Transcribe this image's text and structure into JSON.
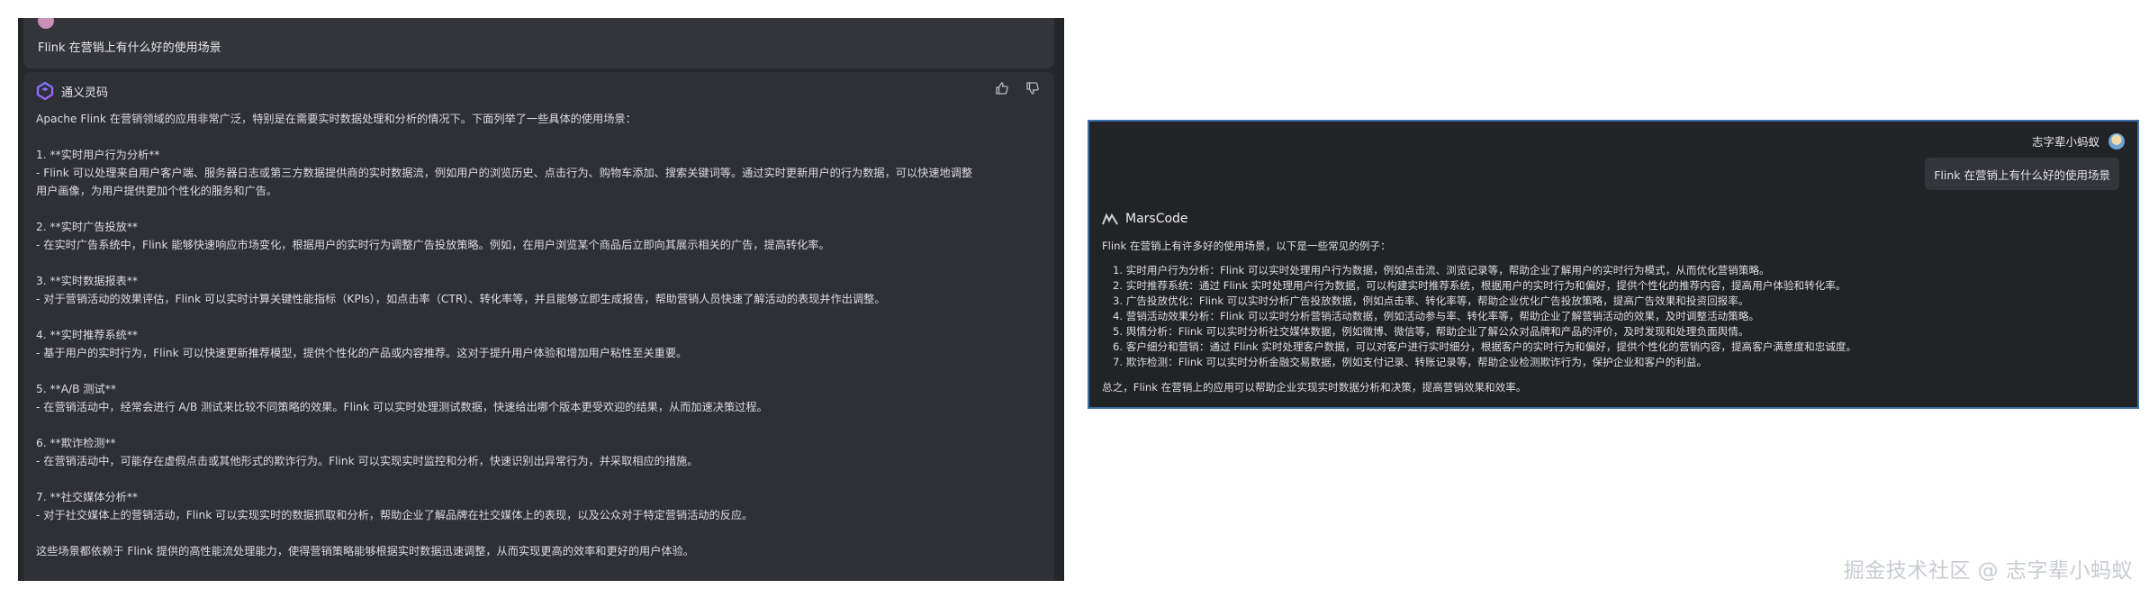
{
  "left": {
    "user_name_cut": "",
    "user_time_cut": "",
    "question": "Flink 在营销上有什么好的使用场景",
    "assistant_name": "通义灵码",
    "actions": [
      "thumbs-up-icon",
      "thumbs-down-icon"
    ],
    "intro": "Apache Flink 在营销领域的应用非常广泛，特别是在需要实时数据处理和分析的情况下。下面列举了一些具体的使用场景：",
    "sections": [
      {
        "title": "1. **实时用户行为分析**",
        "lines": [
          "- Flink 可以处理来自用户客户端、服务器日志或第三方数据提供商的实时数据流，例如用户的浏览历史、点击行为、购物车添加、搜索关键词等。通过实时更新用户的行为数据，可以快速地调整",
          "用户画像，为用户提供更加个性化的服务和广告。"
        ]
      },
      {
        "title": "2. **实时广告投放**",
        "lines": [
          "- 在实时广告系统中，Flink 能够快速响应市场变化，根据用户的实时行为调整广告投放策略。例如，在用户浏览某个商品后立即向其展示相关的广告，提高转化率。"
        ]
      },
      {
        "title": "3. **实时数据报表**",
        "lines": [
          "- 对于营销活动的效果评估，Flink 可以实时计算关键性能指标（KPIs），如点击率（CTR）、转化率等，并且能够立即生成报告，帮助营销人员快速了解活动的表现并作出调整。"
        ]
      },
      {
        "title": "4. **实时推荐系统**",
        "lines": [
          "- 基于用户的实时行为，Flink 可以快速更新推荐模型，提供个性化的产品或内容推荐。这对于提升用户体验和增加用户粘性至关重要。"
        ]
      },
      {
        "title": "5. **A/B 测试**",
        "lines": [
          "- 在营销活动中，经常会进行 A/B 测试来比较不同策略的效果。Flink 可以实时处理测试数据，快速给出哪个版本更受欢迎的结果，从而加速决策过程。"
        ]
      },
      {
        "title": "6. **欺诈检测**",
        "lines": [
          "- 在营销活动中，可能存在虚假点击或其他形式的欺诈行为。Flink 可以实现实时监控和分析，快速识别出异常行为，并采取相应的措施。"
        ]
      },
      {
        "title": "7. **社交媒体分析**",
        "lines": [
          "- 对于社交媒体上的营销活动，Flink 可以实现实时的数据抓取和分析，帮助企业了解品牌在社交媒体上的表现，以及公众对于特定营销活动的反应。"
        ]
      }
    ],
    "conclusion": "这些场景都依赖于 Flink 提供的高性能流处理能力，使得营销策略能够根据实时数据迅速调整，从而实现更高的效率和更好的用户体验。"
  },
  "right": {
    "user_name": "志字辈小蚂蚁",
    "question": "Flink 在营销上有什么好的使用场景",
    "assistant_name": "MarsCode",
    "intro": "Flink 在营销上有许多好的使用场景，以下是一些常见的例子：",
    "items": [
      "1. 实时用户行为分析：Flink 可以实时处理用户行为数据，例如点击流、浏览记录等，帮助企业了解用户的实时行为模式，从而优化营销策略。",
      "2. 实时推荐系统：通过 Flink 实时处理用户行为数据，可以构建实时推荐系统，根据用户的实时行为和偏好，提供个性化的推荐内容，提高用户体验和转化率。",
      "3. 广告投放优化：Flink 可以实时分析广告投放数据，例如点击率、转化率等，帮助企业优化广告投放策略，提高广告效果和投资回报率。",
      "4. 营销活动效果分析：Flink 可以实时分析营销活动数据，例如活动参与率、转化率等，帮助企业了解营销活动的效果，及时调整活动策略。",
      "5. 舆情分析：Flink 可以实时分析社交媒体数据，例如微博、微信等，帮助企业了解公众对品牌和产品的评价，及时发现和处理负面舆情。",
      "6. 客户细分和营销：通过 Flink 实时处理客户数据，可以对客户进行实时细分，根据客户的实时行为和偏好，提供个性化的营销内容，提高客户满意度和忠诚度。",
      "7. 欺诈检测：Flink 可以实时分析金融交易数据，例如支付记录、转账记录等，帮助企业检测欺诈行为，保护企业和客户的利益。"
    ],
    "summary": "总之，Flink 在营销上的应用可以帮助企业实现实时数据分析和决策，提高营销效果和效率。"
  },
  "watermark": "掘金技术社区 @ 志字辈小蚂蚁",
  "colors": {
    "left_bg": "#26272c",
    "card_bg": "#2f3036",
    "right_bg": "#222327",
    "right_border": "#3a6fa8"
  }
}
